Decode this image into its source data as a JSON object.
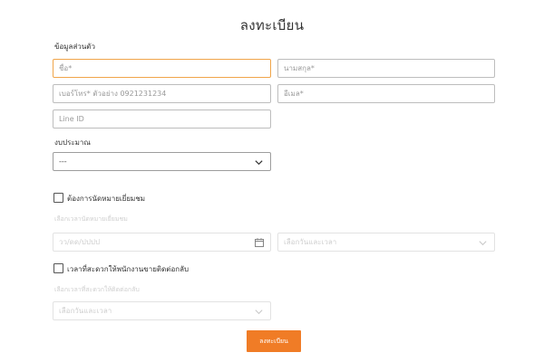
{
  "form": {
    "title": "ลงทะเบียน",
    "personal_section": "ข้อมูลส่วนตัว",
    "first_name_placeholder": "ชื่อ*",
    "last_name_placeholder": "นามสกุล*",
    "phone_placeholder": "เบอร์โทร* ตัวอย่าง 0921231234",
    "email_placeholder": "อีเมล*",
    "line_placeholder": "Line ID",
    "budget_label": "งบประมาณ",
    "budget_value": "---",
    "appointment_checkbox_label": "ต้องการนัดหมายเยี่ยมชม",
    "appointment_hint": "เลือกเวลานัดหมายเยี่ยมชม",
    "date_placeholder": "วว/ดด/ปปปป",
    "time_select_placeholder": "เลือกวันและเวลา",
    "contact_checkbox_label": "เวลาที่สะดวกให้พนักงานขายติดต่อกลับ",
    "contact_hint": "เลือกเวลาที่สะดวกให้ติดต่อกลับ",
    "contact_select_placeholder": "เลือกวันและเวลา",
    "submit_label": "ลงทะเบียน"
  },
  "colors": {
    "accent": "#f07c26",
    "focus_border": "#f0a54a"
  }
}
